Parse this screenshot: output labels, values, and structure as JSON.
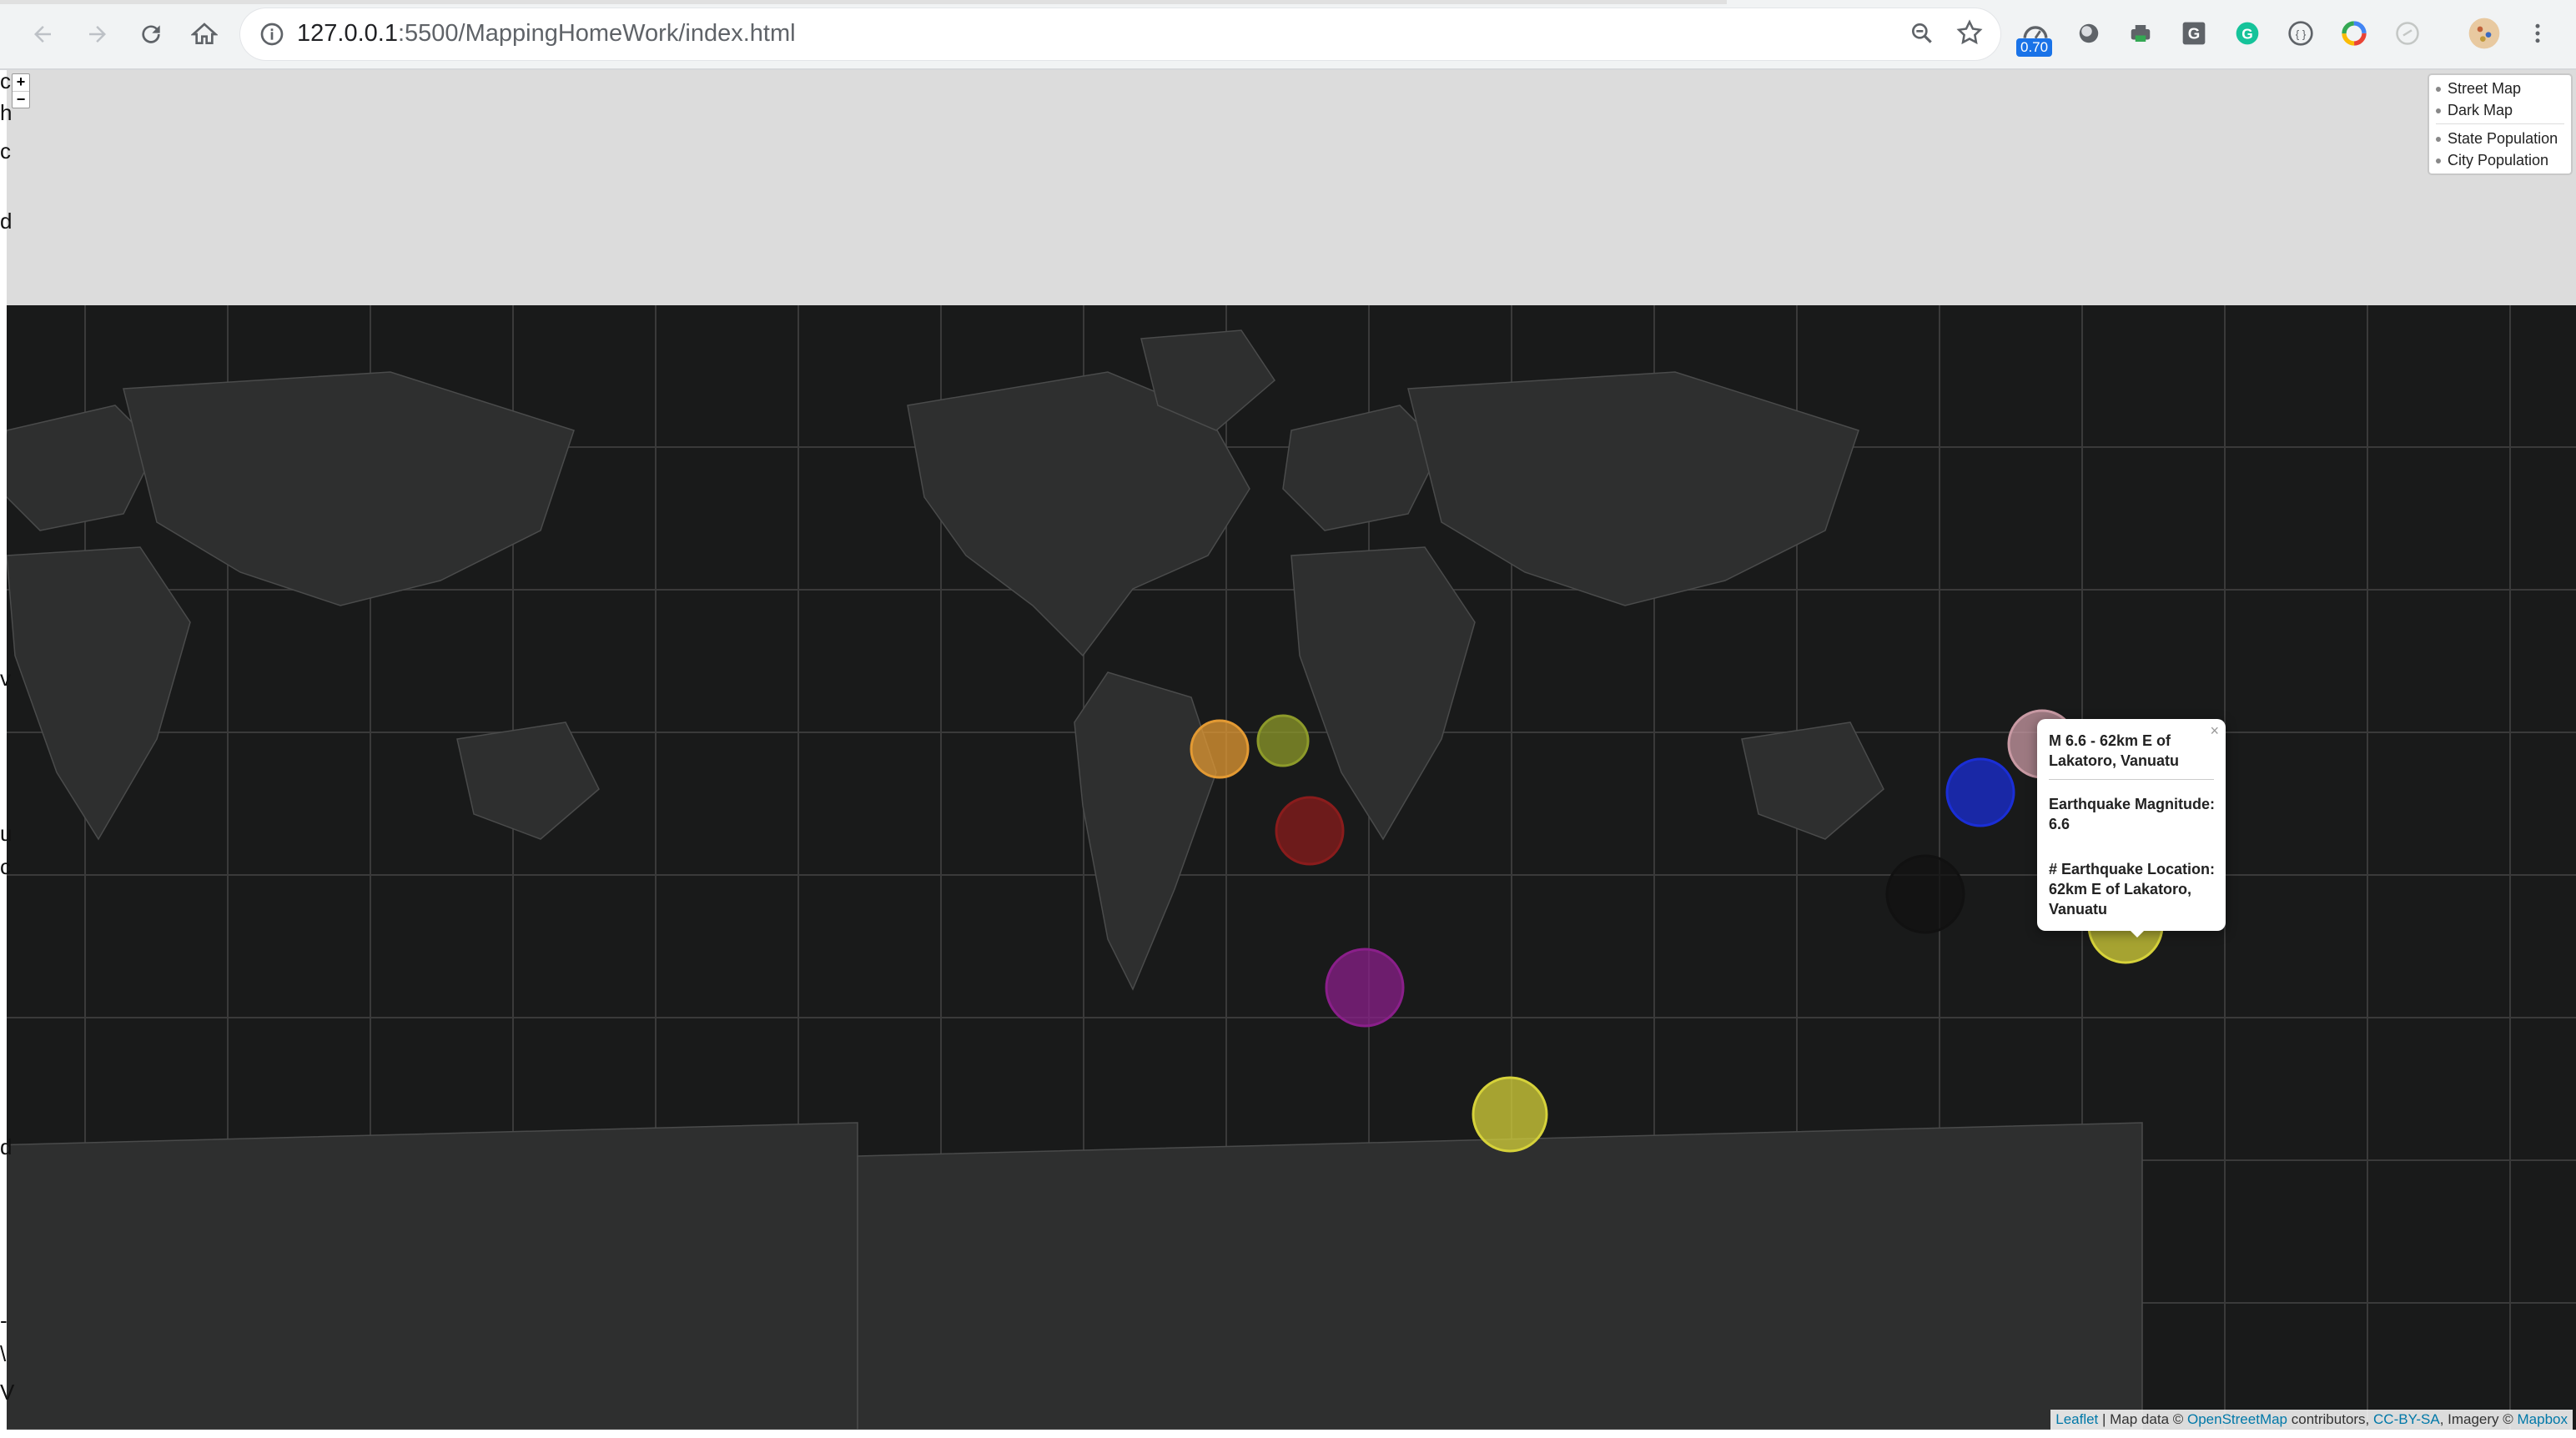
{
  "browser": {
    "url_host": "127.0.0.1",
    "url_rest": ":5500/MappingHomeWork/index.html",
    "extension_badge": "0.70"
  },
  "map": {
    "zoom_in_label": "+",
    "zoom_out_label": "−",
    "layer_control": {
      "base_layers": [
        "Street Map",
        "Dark Map"
      ],
      "overlays": [
        "State Population",
        "City Population"
      ]
    },
    "popup": {
      "title": "M 6.6 - 62km E of Lakatoro, Vanuatu",
      "magnitude_line": "Earthquake Magnitude: 6.6",
      "location_line": "# Earthquake Location: 62km E of Lakatoro, Vanuatu",
      "close_label": "×"
    },
    "attribution": {
      "leaflet": "Leaflet",
      "sep1": " | Map data © ",
      "osm": "OpenStreetMap",
      "sep2": " contributors, ",
      "license": "CC-BY-SA",
      "sep3": ", Imagery © ",
      "mapbox": "Mapbox"
    },
    "markers": [
      {
        "color": "#e39a33",
        "label": "orange"
      },
      {
        "color": "#8d9a2a",
        "label": "olive"
      },
      {
        "color": "#8a1c1c",
        "label": "darkred"
      },
      {
        "color": "#8a1f8a",
        "label": "purple"
      },
      {
        "color": "#d6d23a",
        "label": "yellow"
      },
      {
        "color": "#c99aa4",
        "label": "pink"
      },
      {
        "color": "#1a2ed6",
        "label": "blue"
      },
      {
        "color": "#111111",
        "label": "black"
      },
      {
        "color": "#d6d23a",
        "label": "yellow"
      }
    ]
  },
  "left_gutter_chars": [
    "c",
    "h",
    "c",
    "d",
    "v",
    "u",
    "c",
    "d",
    "-",
    "\\",
    "V"
  ]
}
